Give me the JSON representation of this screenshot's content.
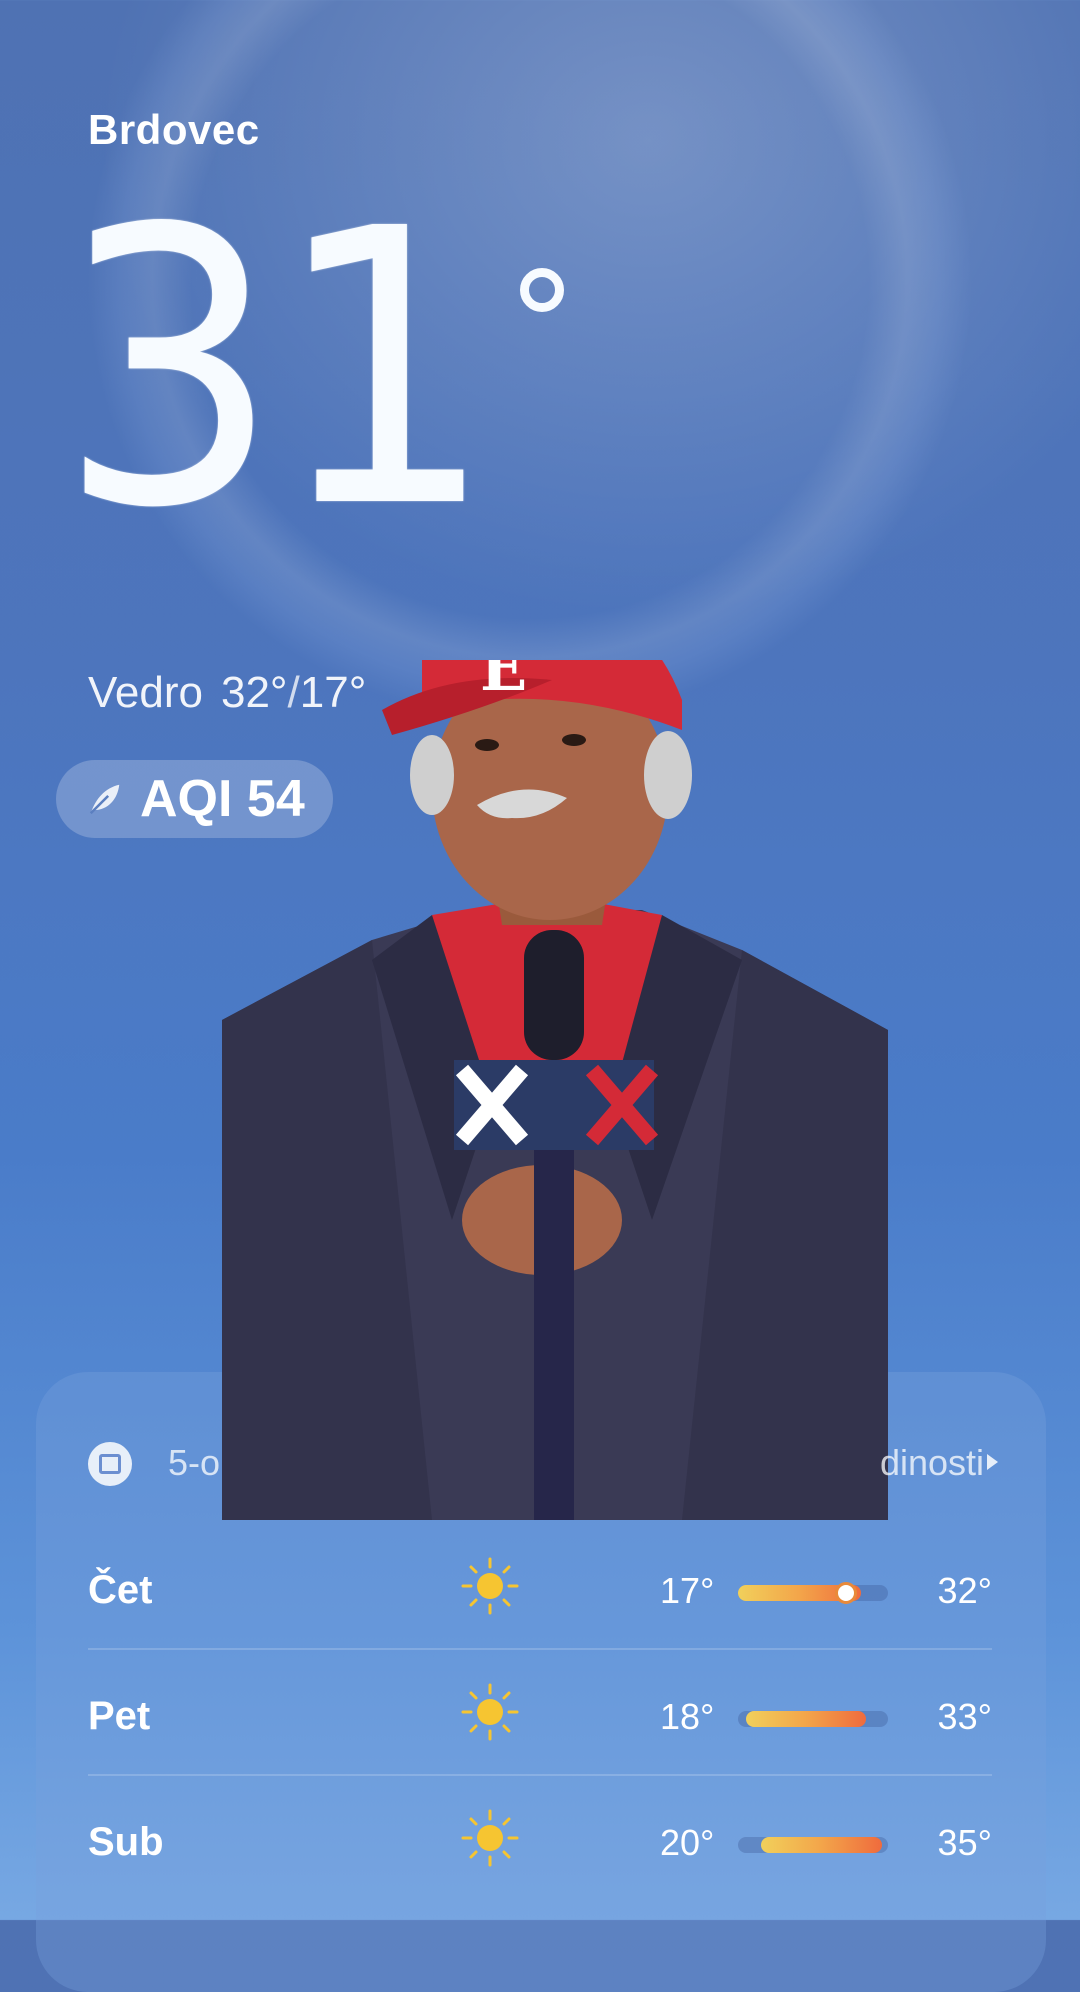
{
  "location": "Brdovec",
  "current": {
    "temperature": "31",
    "condition": "Vedro",
    "high": "32°",
    "low": "17°",
    "aqi_label": "AQI 54"
  },
  "forecast_card": {
    "title": "5-o",
    "more_label": "dinosti",
    "rows": [
      {
        "day": "Čet",
        "low": "17°",
        "high": "32°",
        "icon": "sun-icon",
        "range_start": 0.0,
        "range_end": 0.82,
        "current_marker": 0.7
      },
      {
        "day": "Pet",
        "low": "18°",
        "high": "33°",
        "icon": "sun-icon",
        "range_start": 0.05,
        "range_end": 0.85
      },
      {
        "day": "Sub",
        "low": "20°",
        "high": "35°",
        "icon": "sun-icon",
        "range_start": 0.15,
        "range_end": 0.96
      }
    ]
  },
  "colors": {
    "sky_top": "#4f72b3",
    "sky_bottom": "#77a8e3",
    "bar_start": "#f1d05b",
    "bar_end": "#ef6b3d",
    "cap_red": "#d42a37",
    "jacket": "#3a3a55"
  }
}
